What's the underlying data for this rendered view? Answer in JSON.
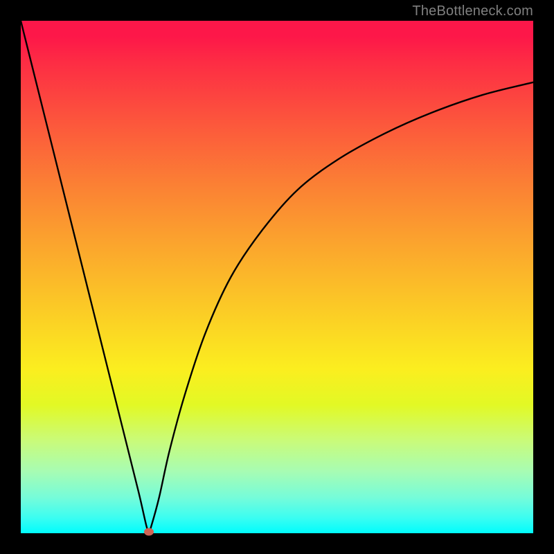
{
  "attribution": "TheBottleneck.com",
  "colors": {
    "frame": "#000000",
    "curve": "#000000",
    "marker": "#cf6456",
    "attribution_text": "#808080"
  },
  "chart_data": {
    "type": "line",
    "title": "",
    "xlabel": "",
    "ylabel": "",
    "xlim": [
      0,
      100
    ],
    "ylim": [
      0,
      100
    ],
    "series": [
      {
        "name": "bottleneck-curve",
        "x": [
          0,
          2,
          5,
          8,
          12,
          16,
          20,
          23,
          24.5,
          25,
          25.5,
          27,
          29,
          32,
          36,
          41,
          47,
          54,
          62,
          71,
          80,
          90,
          100
        ],
        "values": [
          100,
          92,
          80,
          68,
          52,
          36,
          20,
          8,
          1.5,
          0.3,
          1.5,
          7,
          16,
          27,
          39,
          50,
          59,
          67,
          73,
          78,
          82,
          85.5,
          88
        ]
      }
    ],
    "markers": [
      {
        "name": "minimum-point",
        "x": 25,
        "y": 0.3
      }
    ],
    "annotations": []
  }
}
